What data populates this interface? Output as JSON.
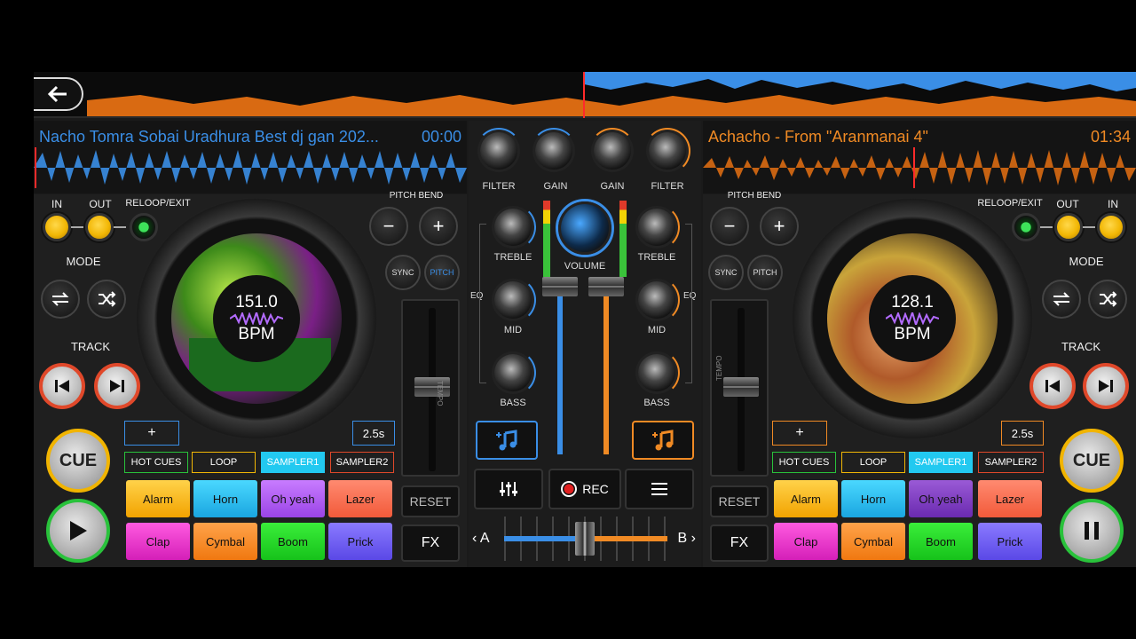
{
  "overview": {
    "back_label": "back"
  },
  "deck_left": {
    "title": "Nacho Tomra Sobai Uradhura Best dj gan 202...",
    "time": "00:00",
    "in_label": "IN",
    "out_label": "OUT",
    "reloop_label": "RELOOP/EXIT",
    "mode_label": "MODE",
    "track_label": "TRACK",
    "bpm_value": "151.0",
    "bpm_unit": "BPM",
    "pitch_bend_label": "PITCH BEND",
    "sync_label": "SYNC",
    "pitch_label": "PITCH",
    "tempo_label": "TEMPO",
    "cue_label": "CUE",
    "plus_label": "+",
    "loop_len": "2.5s",
    "tabs": [
      "HOT CUES",
      "LOOP",
      "SAMPLER1",
      "SAMPLER2"
    ],
    "pads": [
      "Alarm",
      "Horn",
      "Oh yeah",
      "Lazer",
      "Clap",
      "Cymbal",
      "Boom",
      "Prick"
    ],
    "reset_label": "RESET",
    "fx_label": "FX"
  },
  "deck_right": {
    "title": "Achacho - From \"Aranmanai 4\"",
    "time": "01:34",
    "in_label": "IN",
    "out_label": "OUT",
    "reloop_label": "RELOOP/EXIT",
    "mode_label": "MODE",
    "track_label": "TRACK",
    "bpm_value": "128.1",
    "bpm_unit": "BPM",
    "pitch_bend_label": "PITCH BEND",
    "sync_label": "SYNC",
    "pitch_label": "PITCH",
    "tempo_label": "TEMPO",
    "cue_label": "CUE",
    "plus_label": "+",
    "loop_len": "2.5s",
    "tabs": [
      "HOT CUES",
      "LOOP",
      "SAMPLER1",
      "SAMPLER2"
    ],
    "pads": [
      "Alarm",
      "Horn",
      "Oh yeah",
      "Lazer",
      "Clap",
      "Cymbal",
      "Boom",
      "Prick"
    ],
    "reset_label": "RESET",
    "fx_label": "FX"
  },
  "mixer": {
    "filter_label": "FILTER",
    "gain_label": "GAIN",
    "treble_label": "TREBLE",
    "volume_label": "VOLUME",
    "eq_label": "EQ",
    "mid_label": "MID",
    "bass_label": "BASS",
    "rec_label": "REC",
    "a_label": "A",
    "b_label": "B",
    "crossfader_position": 0.5
  },
  "colors": {
    "deck_a": "#3a8ee6",
    "deck_b": "#f08a24",
    "yellow": "#f2b705",
    "green": "#29c23b",
    "red": "#e0482a"
  }
}
